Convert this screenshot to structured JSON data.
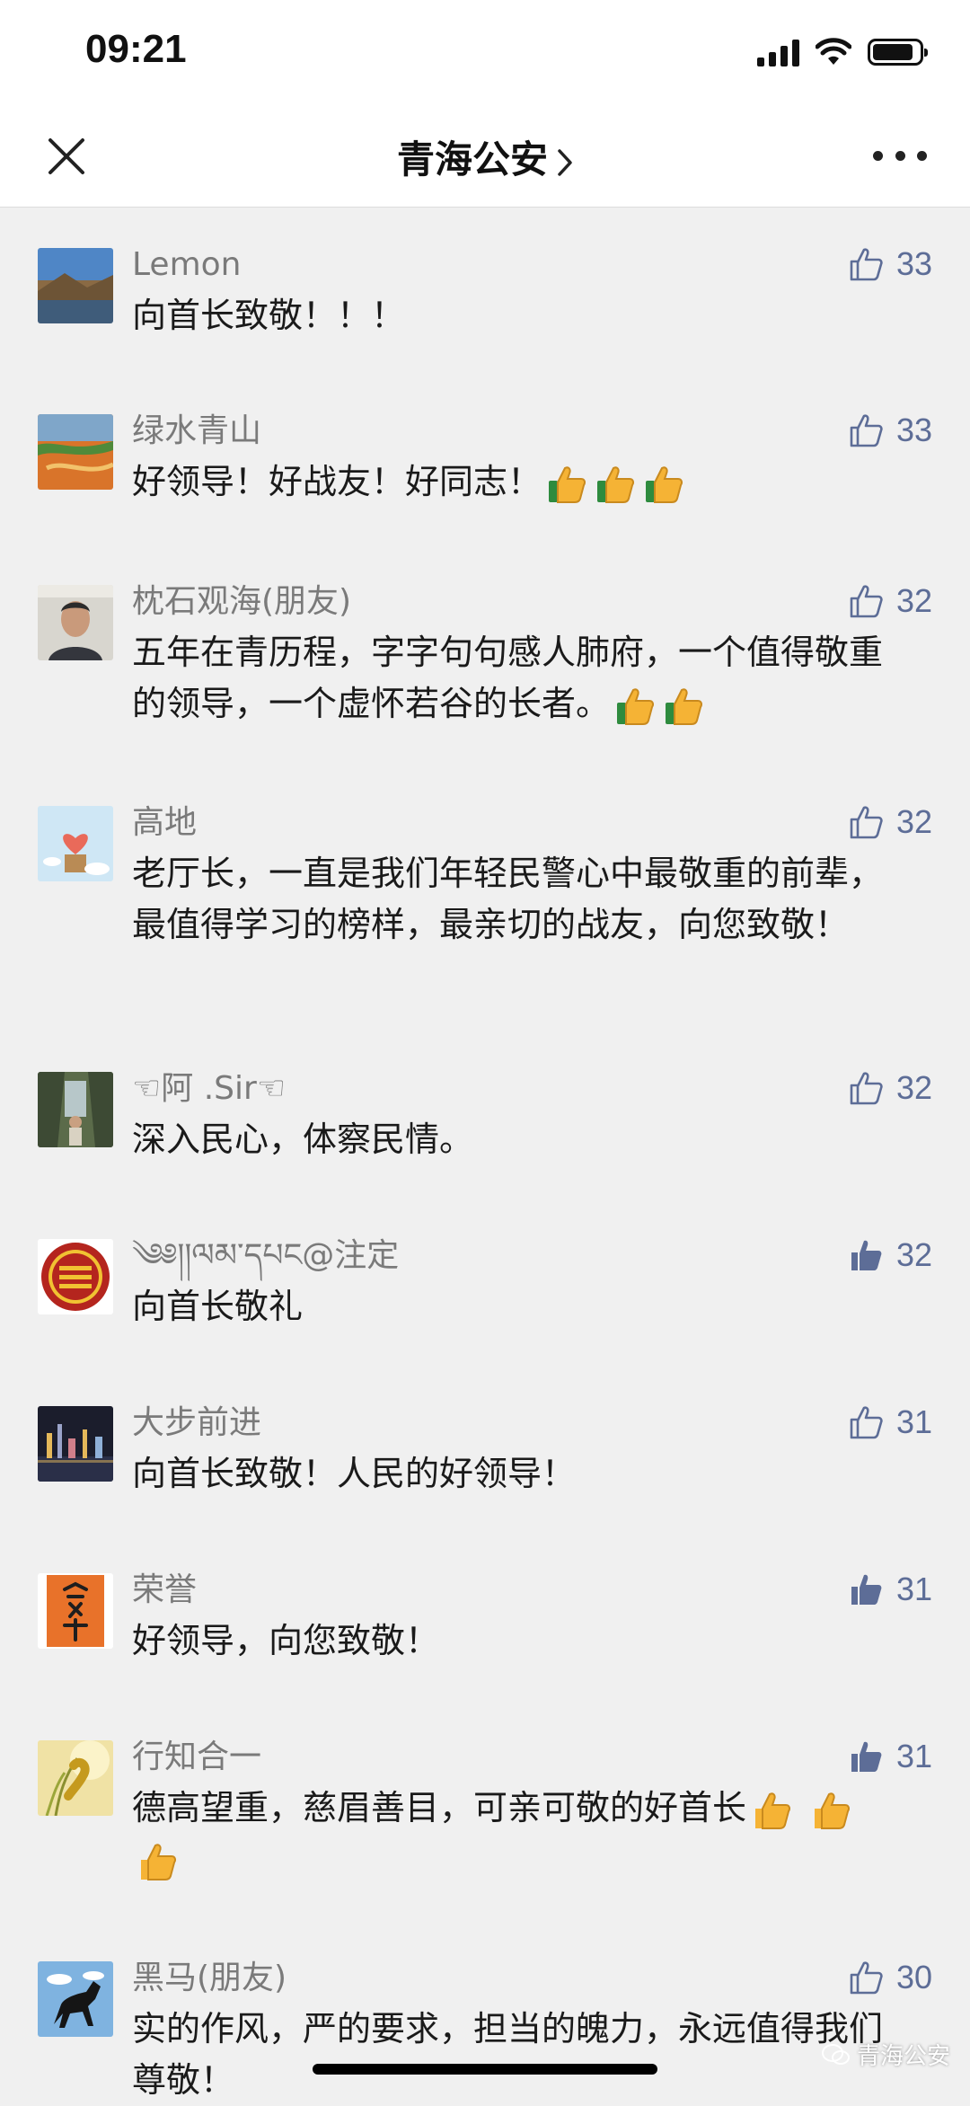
{
  "status_bar": {
    "time": "09:21"
  },
  "header": {
    "title": "青海公安",
    "chevron": "chevron-right-icon",
    "close_icon": "close-icon",
    "more_icon": "more-icon"
  },
  "colors": {
    "like_blue": "#5d6d97",
    "nickname_gray": "#7a7a7a",
    "background": "#f0f0f0"
  },
  "comments": [
    {
      "nickname": "Lemon",
      "text": "向首长致敬！！！",
      "likes": "33",
      "liked": false
    },
    {
      "nickname": "绿水青山",
      "text": "好领导！好战友！好同志！",
      "likes": "33",
      "liked": false,
      "thumbs": 3
    },
    {
      "nickname": "枕石观海(朋友)",
      "text": "五年在青历程，字字句句感人肺府，一个值得敬重的领导，一个虚怀若谷的长者。",
      "likes": "32",
      "liked": false,
      "thumbs": 2
    },
    {
      "nickname": "高地",
      "text": "老厅长，一直是我们年轻民警心中最敬重的前辈，最值得学习的榜样，最亲切的战友，向您致敬！",
      "likes": "32",
      "liked": false
    },
    {
      "nickname": "☜阿 .Sir☜",
      "text": "深入民心，体察民情。",
      "likes": "32",
      "liked": false
    },
    {
      "nickname": "༄༅།།ལམ་དཔང@注定",
      "text": "向首长敬礼",
      "likes": "32",
      "liked": true
    },
    {
      "nickname": "大步前进",
      "text": "向首长致敬！人民的好领导！",
      "likes": "31",
      "liked": false
    },
    {
      "nickname": "荣誉",
      "text": "好领导，向您致敬！",
      "likes": "31",
      "liked": true
    },
    {
      "nickname": "行知合一",
      "text": "德高望重，慈眉善目，可亲可敬的好首长",
      "likes": "31",
      "liked": true,
      "thumbs": 3
    },
    {
      "nickname": "黑马(朋友)",
      "text": "实的作风，严的要求，担当的魄力，永远值得我们尊敬！",
      "likes": "30",
      "liked": false
    }
  ],
  "watermark": {
    "text": "青海公安"
  }
}
